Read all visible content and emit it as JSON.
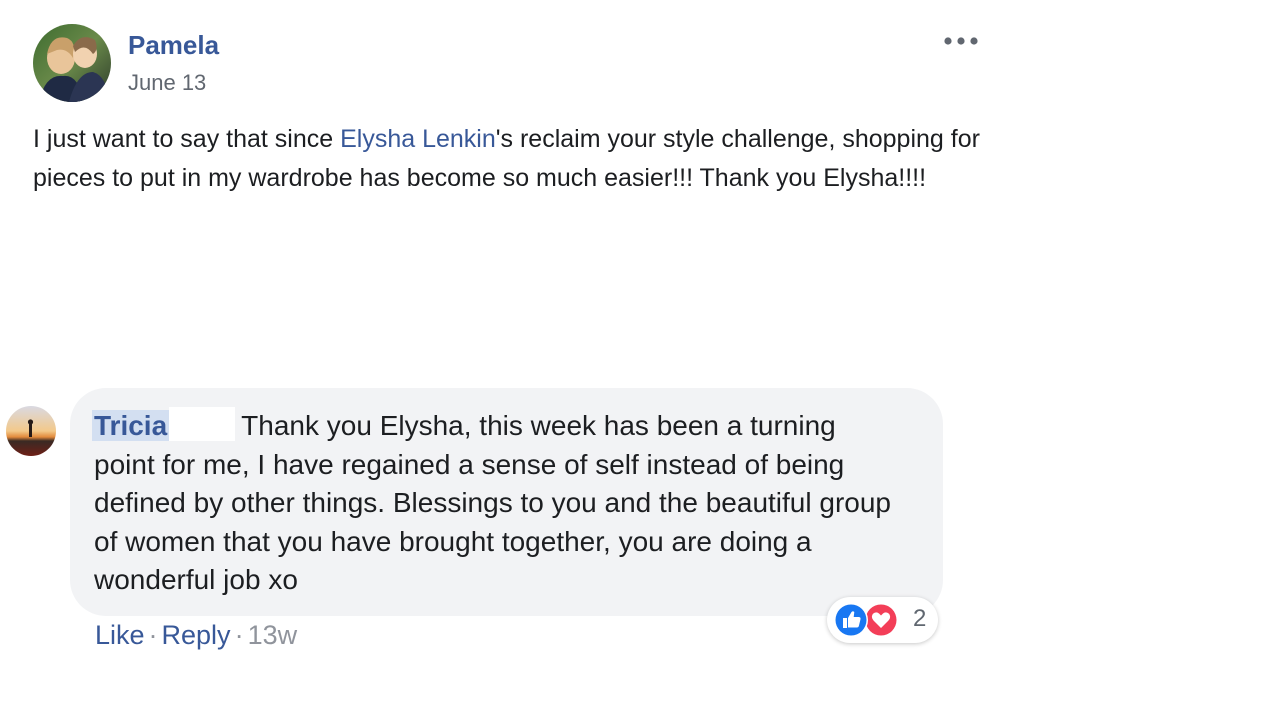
{
  "post": {
    "author": "Pamela",
    "date": "June 13",
    "body_before": "I just want to say that since ",
    "mention": "Elysha Lenkin",
    "body_after": "'s reclaim your style challenge, shopping for pieces to put in my wardrobe has become so much easier!!! Thank you Elysha!!!!"
  },
  "comment": {
    "author": "Tricia",
    "text": "Thank you Elysha, this week has been a turning point for me, I have regained a sense of self instead of being defined by other things. Blessings to you and the beautiful group of women that you have brought together, you are doing a wonderful job xo",
    "reactions": {
      "types": [
        "like-icon",
        "love-icon"
      ],
      "count": "2"
    },
    "actions": {
      "like": "Like",
      "separator": "·",
      "reply": "Reply",
      "time": "13w"
    }
  },
  "colors": {
    "link": "#385898",
    "bubble": "#f2f3f5",
    "meta": "#90949c",
    "like_blue": "#1877f2",
    "love_red": "#f33e58"
  }
}
